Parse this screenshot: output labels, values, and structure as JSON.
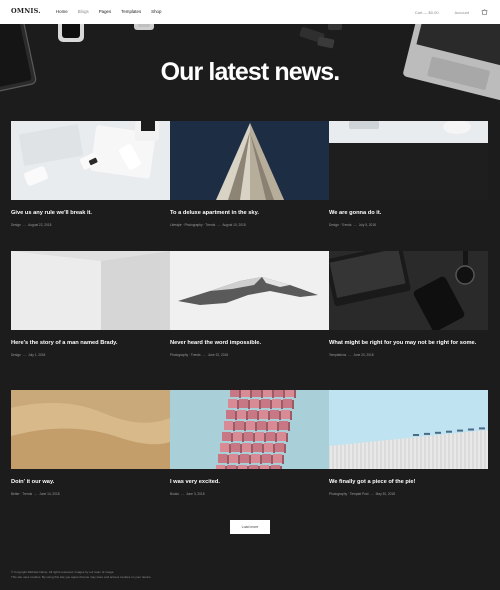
{
  "header": {
    "logo": "OMNIS.",
    "nav": [
      {
        "label": "Home",
        "muted": false
      },
      {
        "label": "Blogs",
        "muted": true
      },
      {
        "label": "Pages",
        "muted": false
      },
      {
        "label": "Templates",
        "muted": false
      },
      {
        "label": "Shop",
        "muted": false
      }
    ],
    "cart_text": "Cart — $0.00",
    "account_text": "Account",
    "cart_icon": "shopping-bag-icon"
  },
  "hero": {
    "title": "Our latest news."
  },
  "posts": [
    {
      "title": "Give us any rule we'll break it.",
      "meta": [
        "Design",
        "August 22, 2018"
      ],
      "image": "workspace-tablet-desk"
    },
    {
      "title": "To a deluxe apartment in the sky.",
      "meta": [
        "Lifestyle · Photography · Trends",
        "August 10, 2018"
      ],
      "image": "skyscraper-facade"
    },
    {
      "title": "We are gonna do it.",
      "meta": [
        "Design · Trends",
        "July 5, 2018"
      ],
      "image": "desk-keyboard-mouse"
    },
    {
      "title": "Here's the story of a man named Brady.",
      "meta": [
        "Design",
        "July 1, 2018"
      ],
      "image": "white-wall-corner"
    },
    {
      "title": "Never heard the word impossible.",
      "meta": [
        "Photography · Trends",
        "June 22, 2018"
      ],
      "image": "snowy-mountain"
    },
    {
      "title": "What might be right for you may not be right for some.",
      "meta": [
        "Temptations",
        "June 20, 2018"
      ],
      "image": "dark-laptop-watch"
    },
    {
      "title": "Doin' it our way.",
      "meta": [
        "Better · Trends",
        "June 14, 2018"
      ],
      "image": "sand-dune"
    },
    {
      "title": "I was very excited.",
      "meta": [
        "Books",
        "June 3, 2018"
      ],
      "image": "pink-cube-building"
    },
    {
      "title": "We finally got a piece of the pie!",
      "meta": [
        "Photography · Temptat Post",
        "May 30, 2018"
      ],
      "image": "white-building-sky"
    }
  ],
  "load_more": "Load more",
  "footer": {
    "line1": "© Copyright Website Name. All rights reserved. Images by our team of image.",
    "line2": "This site uses cookies. By using this site you agree that we may store and access cookies on your device."
  }
}
